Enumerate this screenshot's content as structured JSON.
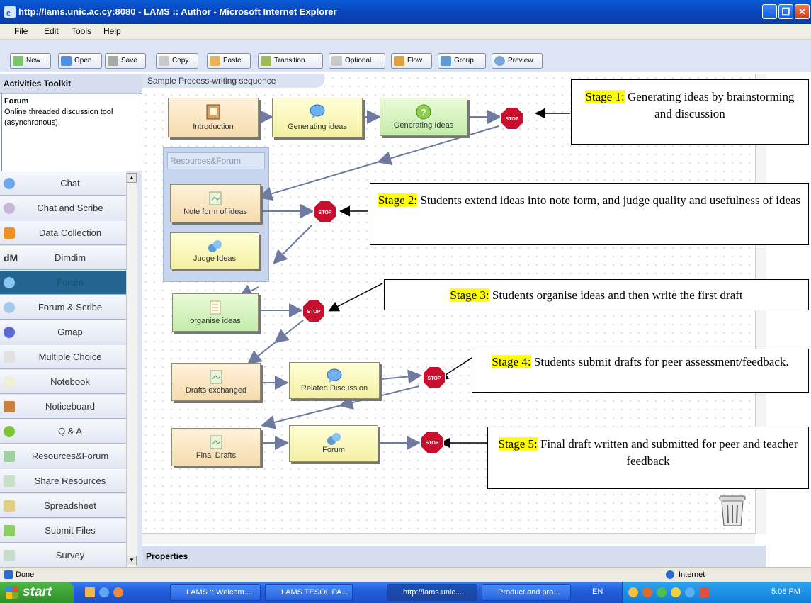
{
  "window": {
    "title": "http://lams.unic.ac.cy:8080 - LAMS :: Author - Microsoft Internet Explorer",
    "minimize": "_",
    "maximize": "❐",
    "close": "✕"
  },
  "menu": [
    "File",
    "Edit",
    "Tools",
    "Help"
  ],
  "toolbar": [
    "New",
    "Open",
    "Save",
    "Copy",
    "Paste",
    "Transition",
    "Optional",
    "Flow",
    "Group",
    "Preview"
  ],
  "toolkit": {
    "header": "Activities Toolkit",
    "desc_title": "Forum",
    "desc_text": "Online threaded discussion tool (asynchronous).",
    "items": [
      "Chat",
      "Chat and Scribe",
      "Data Collection",
      "Dimdim",
      "Forum",
      "Forum & Scribe",
      "Gmap",
      "Multiple Choice",
      "Notebook",
      "Noticeboard",
      "Q & A",
      "Resources&Forum",
      "Share Resources",
      "Spreadsheet",
      "Submit Files",
      "Survey"
    ]
  },
  "canvas": {
    "tab": "Sample Process-writing sequence",
    "group_title": "Resources&Forum",
    "activities": {
      "introduction": "Introduction",
      "generating_ideas_chat": "Generating ideas",
      "generating_ideas_qa": "Generating Ideas",
      "note_form": "Note form of ideas",
      "judge_ideas": "Judge Ideas",
      "organise_ideas": "organise ideas",
      "drafts_exchanged": "Drafts exchanged",
      "related_discussion": "Related Discussion",
      "final_drafts": "Final Drafts",
      "forum": "Forum"
    },
    "stop_label": "STOP"
  },
  "callouts": [
    {
      "stage": "Stage 1:",
      "text": " Generating ideas by brainstorming and discussion"
    },
    {
      "stage": "Stage 2:",
      "text": " Students extend ideas into note form, and judge quality and usefulness of ideas"
    },
    {
      "stage": "Stage 3:",
      "text": " Students organise ideas and then write the first draft"
    },
    {
      "stage": "Stage 4:",
      "text": " Students submit drafts for peer assessment/feedback."
    },
    {
      "stage": "Stage 5:",
      "text": " Final draft written and submitted for peer and teacher feedback"
    }
  ],
  "properties": "Properties",
  "status": {
    "left": "Done",
    "zone": "Internet"
  },
  "taskbar": {
    "start": "start",
    "tasks": [
      "LAMS :: Welcom...",
      "LAMS TESOL PA...",
      "http://lams.unic....",
      "Product and pro..."
    ],
    "lang": "EN",
    "clock": "5:08 PM"
  },
  "colors": {
    "highlight": "#ffff00",
    "titlebar": "#0a4fc7",
    "stop": "#c8102e",
    "transition": "#6e7aa0"
  }
}
